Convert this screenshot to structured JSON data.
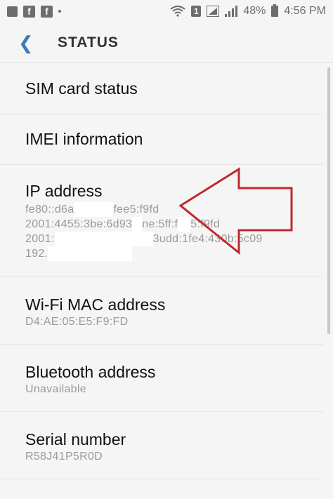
{
  "status_bar": {
    "battery": "48%",
    "time": "4:56 PM",
    "sim_badge": "1",
    "fb_icon_label": "f"
  },
  "header": {
    "title": "STATUS"
  },
  "items": [
    {
      "label": "SIM card status"
    },
    {
      "label": "IMEI information"
    },
    {
      "label": "IP address",
      "lines": [
        "fe80::d6a",
        "fee5:f9fd",
        "2001:4455:3be:6d93",
        "ne:5ff:f",
        "5:f9fd",
        "2001:",
        "3udd:1fe4:430b:5c09",
        "192."
      ]
    },
    {
      "label": "Wi-Fi MAC address",
      "value": "D4:AE:05:E5:F9:FD"
    },
    {
      "label": "Bluetooth address",
      "value": "Unavailable"
    },
    {
      "label": "Serial number",
      "value": "R58J41P5R0D"
    }
  ],
  "colors": {
    "accent": "#3a7bb8",
    "arrow": "#c0282d"
  }
}
